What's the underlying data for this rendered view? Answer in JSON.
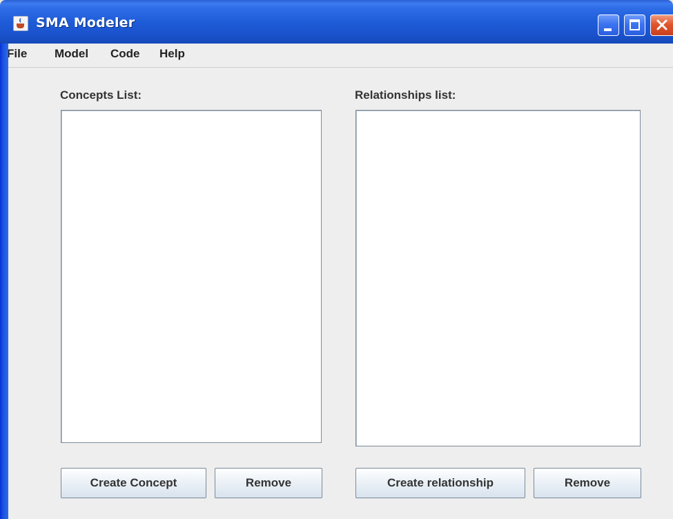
{
  "window": {
    "title": "SMA Modeler",
    "icon": "java-cup-icon"
  },
  "title_bar_buttons": [
    "minimize",
    "maximize",
    "close"
  ],
  "menubar": {
    "items": [
      "File",
      "Model",
      "Code",
      "Help"
    ]
  },
  "concepts": {
    "label": "Concepts List:",
    "items": [],
    "create_label": "Create Concept",
    "remove_label": "Remove"
  },
  "relationships": {
    "label": "Relationships list:",
    "items": [],
    "create_label": "Create relationship",
    "remove_label": "Remove"
  },
  "colors": {
    "titlebar": "#1F5CD8",
    "close_button": "#E2562E",
    "panel_bg": "#EEEEEE"
  }
}
